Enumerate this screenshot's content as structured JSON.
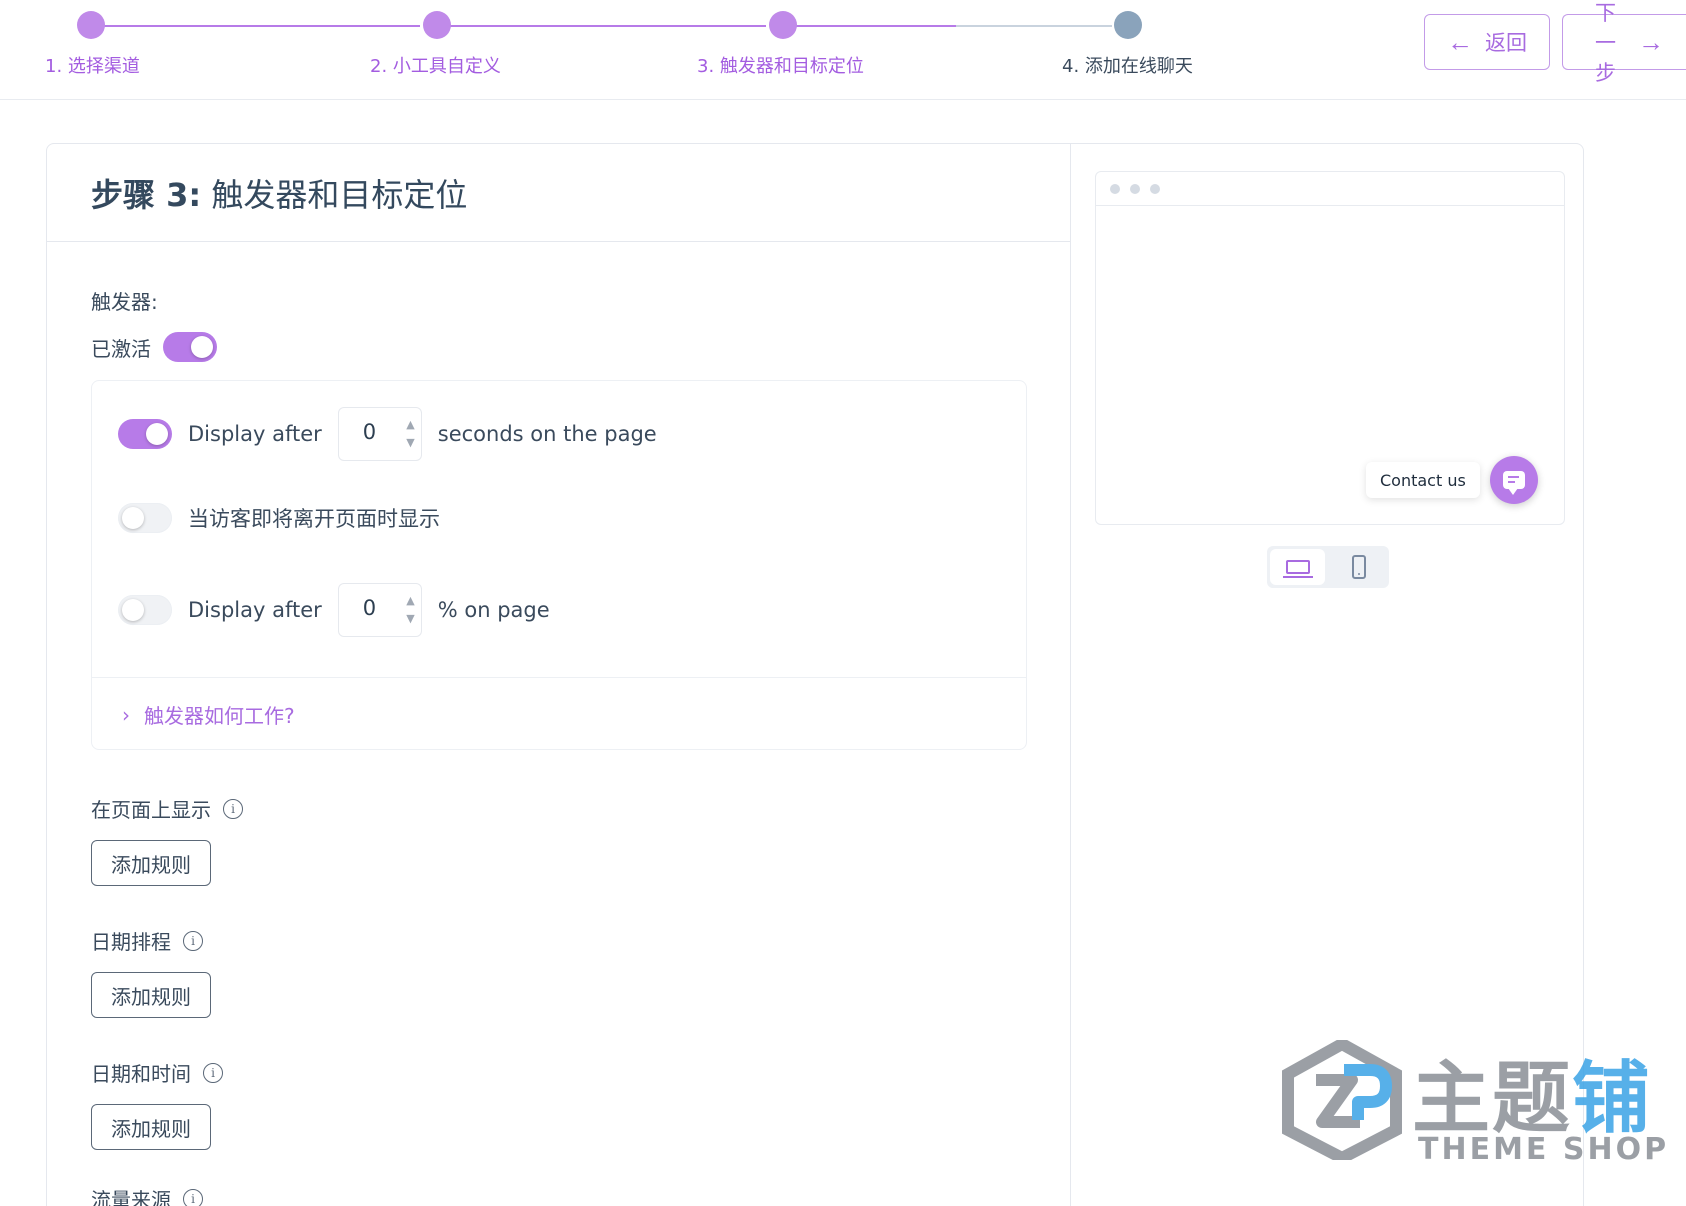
{
  "stepper": {
    "steps": [
      {
        "label": "1. 选择渠道",
        "state": "done"
      },
      {
        "label": "2. 小工具自定义",
        "state": "done"
      },
      {
        "label": "3. 触发器和目标定位",
        "state": "done"
      },
      {
        "label": "4. 添加在线聊天",
        "state": "current"
      }
    ],
    "back_label": "返回",
    "next_label": "下一步"
  },
  "colors": {
    "accent": "#b77be8",
    "accent_text": "#a86be0",
    "current_step": "#8aa3bb",
    "line_pending": "#c9d3de"
  },
  "page": {
    "title_prefix": "步骤 3:",
    "title_rest": " 触发器和目标定位"
  },
  "triggers": {
    "section_label": "触发器:",
    "activated_label": "已激活",
    "activated": true,
    "row1": {
      "enabled": true,
      "prefix": "Display after",
      "value": "0",
      "suffix": "seconds on the page"
    },
    "row2": {
      "enabled": false,
      "label": "当访客即将离开页面时显示"
    },
    "row3": {
      "enabled": false,
      "prefix": "Display after",
      "value": "0",
      "suffix": "% on page"
    },
    "help_label": "触发器如何工作?"
  },
  "targeting": {
    "show_on_pages": {
      "label": "在页面上显示",
      "button": "添加规则"
    },
    "date_schedule": {
      "label": "日期排程",
      "button": "添加规则"
    },
    "date_time": {
      "label": "日期和时间",
      "button": "添加规则"
    },
    "traffic_source": {
      "label": "流量来源"
    }
  },
  "preview": {
    "contact_label": "Contact us",
    "device": "desktop"
  },
  "watermark": {
    "text_gray": "主题",
    "text_blue": "铺",
    "sub": "THEME SHOP"
  }
}
